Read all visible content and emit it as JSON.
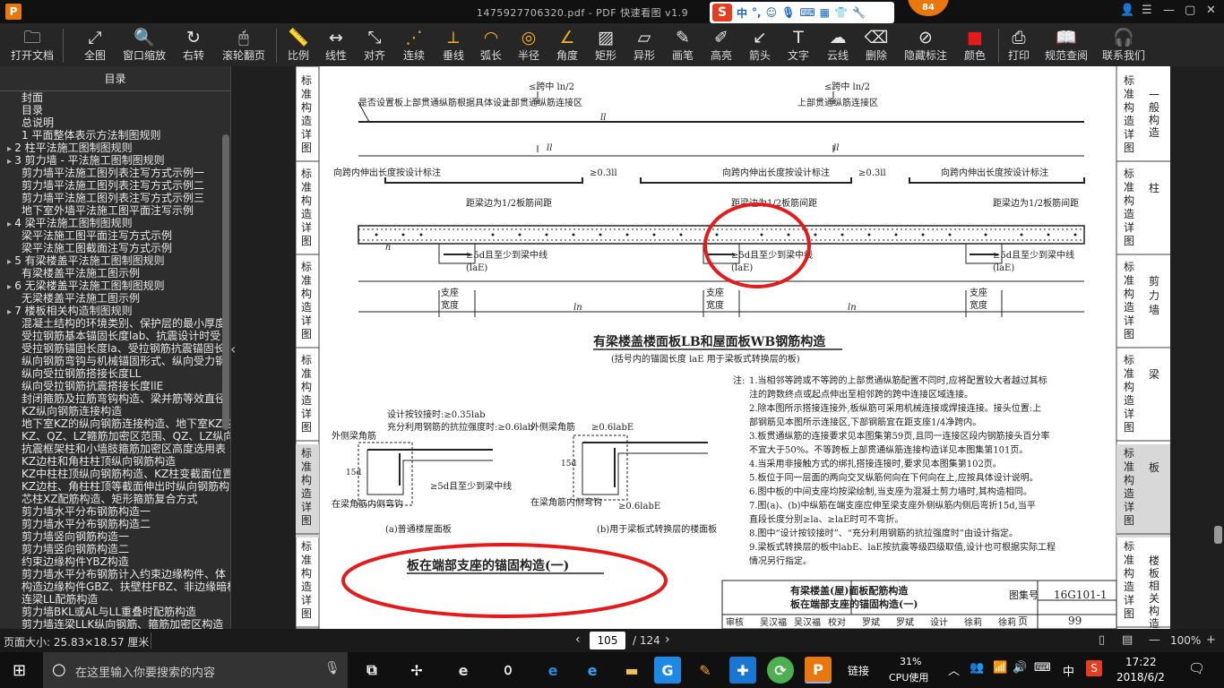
{
  "window": {
    "title": "1475927706320.pdf - PDF 快速看图 v1.9",
    "logo": "P",
    "badge": "84"
  },
  "ime": {
    "logo": "S",
    "mode": "中",
    "punct": "°,",
    "icons": [
      "smile-icon",
      "mic-icon",
      "keyboard-icon",
      "grid-icon",
      "shirt-icon",
      "wrench-icon"
    ]
  },
  "toolbar": [
    {
      "id": "open",
      "label": "打开文档",
      "icon": "folder-icon"
    },
    {
      "id": "fit",
      "label": "全图",
      "icon": "expand-icon"
    },
    {
      "id": "zoomwin",
      "label": "窗口缩放",
      "icon": "magnifier-icon"
    },
    {
      "id": "rotate",
      "label": "右转",
      "icon": "rotate-icon"
    },
    {
      "id": "scroll",
      "label": "滚轮翻页",
      "icon": "mouse-icon"
    },
    {
      "id": "scale",
      "label": "比例",
      "icon": "ruler-icon"
    },
    {
      "id": "linear",
      "label": "线性",
      "icon": "linear-dim-icon"
    },
    {
      "id": "align",
      "label": "对齐",
      "icon": "aligned-dim-icon"
    },
    {
      "id": "cont",
      "label": "连续",
      "icon": "continuous-icon"
    },
    {
      "id": "perp",
      "label": "垂线",
      "icon": "perpendicular-icon"
    },
    {
      "id": "arc",
      "label": "弧长",
      "icon": "arc-icon"
    },
    {
      "id": "radius",
      "label": "半径",
      "icon": "radius-icon"
    },
    {
      "id": "angle",
      "label": "角度",
      "icon": "angle-icon"
    },
    {
      "id": "rect",
      "label": "矩形",
      "icon": "rect-area-icon"
    },
    {
      "id": "irreg",
      "label": "异形",
      "icon": "irregular-area-icon"
    },
    {
      "id": "pen",
      "label": "画笔",
      "icon": "pen-icon"
    },
    {
      "id": "hl",
      "label": "高亮",
      "icon": "highlighter-icon"
    },
    {
      "id": "arrow",
      "label": "箭头",
      "icon": "arrow-icon"
    },
    {
      "id": "text",
      "label": "文字",
      "icon": "text-icon"
    },
    {
      "id": "cloud",
      "label": "云线",
      "icon": "cloud-icon"
    },
    {
      "id": "del",
      "label": "删除",
      "icon": "eraser-icon"
    },
    {
      "id": "hide",
      "label": "隐藏标注",
      "icon": "eye-off-icon"
    },
    {
      "id": "color",
      "label": "颜色",
      "icon": "color-swatch-icon"
    },
    {
      "id": "print",
      "label": "打印",
      "icon": "printer-icon"
    },
    {
      "id": "spec",
      "label": "规范查阅",
      "icon": "book-icon"
    },
    {
      "id": "contact",
      "label": "联系我们",
      "icon": "headset-icon"
    }
  ],
  "colors": {
    "swatch": "#ff0000",
    "accent": "#f2b01d",
    "markup": "#e51b1b"
  },
  "sidebar": {
    "title": "目录",
    "items": [
      {
        "t": "封面",
        "ar": false
      },
      {
        "t": "目录",
        "ar": false
      },
      {
        "t": "总说明",
        "ar": false
      },
      {
        "t": "1  平面整体表示方法制图规则",
        "ar": false
      },
      {
        "t": "2  柱平法施工图制图规则",
        "ar": true
      },
      {
        "t": "3  剪力墙 - 平法施工图制图规则",
        "ar": true
      },
      {
        "t": "剪力墙平法施工图列表注写方式示例一",
        "ar": false
      },
      {
        "t": "剪力墙平法施工图列表注写方式示例二",
        "ar": false
      },
      {
        "t": "剪力墙平法施工图列表注写方式示例三",
        "ar": false
      },
      {
        "t": "地下室外墙平法施工图平面注写示例",
        "ar": false
      },
      {
        "t": "4  梁平法施工图制图规则",
        "ar": true
      },
      {
        "t": "梁平法施工图平面注写方式示例",
        "ar": false
      },
      {
        "t": "梁平法施工图截面注写方式示例",
        "ar": false
      },
      {
        "t": "5  有梁楼盖平法施工图制图规则",
        "ar": true
      },
      {
        "t": "有梁楼盖平法施工图示例",
        "ar": false
      },
      {
        "t": "6  无梁楼盖平法施工图制图规则",
        "ar": true
      },
      {
        "t": "无梁楼盖平法施工图示例",
        "ar": false
      },
      {
        "t": "7  楼板相关构造制图规则",
        "ar": true
      },
      {
        "t": "混凝土结构的环境类别、保护层的最小厚度",
        "ar": false
      },
      {
        "t": "受拉钢筋基本锚固长度lab、抗震设计时受",
        "ar": false
      },
      {
        "t": "受拉钢筋锚固长度la、受拉钢筋抗震锚固长",
        "ar": false
      },
      {
        "t": "纵向钢筋弯钩与机械锚固形式、纵向受力钢",
        "ar": false
      },
      {
        "t": "纵向受拉钢筋搭接长度LL",
        "ar": false
      },
      {
        "t": "纵向受拉钢筋抗震搭接长度llE",
        "ar": false
      },
      {
        "t": "封闭箍筋及拉筋弯钩构造、梁并筋等效直径",
        "ar": false
      },
      {
        "t": "KZ纵向钢筋连接构造",
        "ar": false
      },
      {
        "t": "地下室KZ的纵向钢筋连接构造、地下室KZ的",
        "ar": false
      },
      {
        "t": "KZ、QZ、LZ箍筋加密区范围、QZ、LZ纵向钢",
        "ar": false
      },
      {
        "t": "抗震框架柱和小墙肢箍筋加密区高度选用表",
        "ar": false
      },
      {
        "t": "KZ边柱和角柱柱顶纵向钢筋构造",
        "ar": false
      },
      {
        "t": "KZ中柱柱顶纵向钢筋构造、KZ柱变截面位置",
        "ar": false
      },
      {
        "t": "KZ边柱、角柱柱顶等截面伸出时纵向钢筋构",
        "ar": false
      },
      {
        "t": "芯柱XZ配筋构造、矩形箍筋复合方式",
        "ar": false
      },
      {
        "t": "剪力墙水平分布钢筋构造一",
        "ar": false
      },
      {
        "t": "剪力墙水平分布钢筋构造二",
        "ar": false
      },
      {
        "t": "剪力墙竖向钢筋构造一",
        "ar": false
      },
      {
        "t": "剪力墙竖向钢筋构造二",
        "ar": false
      },
      {
        "t": "约束边缘构件YBZ构造",
        "ar": false
      },
      {
        "t": "剪力墙水平分布钢筋计入约束边缘构件、体",
        "ar": false
      },
      {
        "t": "构造边缘构件GBZ、扶壁柱FBZ、非边缘暗柱",
        "ar": false
      },
      {
        "t": "连梁LL配筋构造",
        "ar": false
      },
      {
        "t": "剪力墙BKL或AL与LL重叠时配筋构造",
        "ar": false
      },
      {
        "t": "剪力墙连梁LLK纵向钢筋、箍筋加密区构造",
        "ar": false
      }
    ]
  },
  "drawing": {
    "side_tabs_left": [
      "标准构造详图",
      "标准构造详图",
      "标准构造详图",
      "标准构造详图",
      "标准构造详图",
      "标准构造详图"
    ],
    "side_tabs_right": [
      {
        "t": "标准构造详图",
        "k": "一般构造"
      },
      {
        "t": "标准构造详图",
        "k": "柱"
      },
      {
        "t": "标准构造详图",
        "k": "剪力墙"
      },
      {
        "t": "标准构造详图",
        "k": "梁"
      },
      {
        "t": "标准构造详图",
        "k": "板"
      },
      {
        "t": "标准构造详图",
        "k": "楼板相关构造"
      }
    ],
    "top_label_left": "是否设置板上部贯通纵筋根据具体设计",
    "span_label_1": "≤跨中 ln/2",
    "span_label_2": "≤跨中 ln/2",
    "splice_zone_1": "上部贯通纵筋连接区",
    "splice_zone_2": "上部贯通纵筋连接区",
    "ll1": "ll",
    "ll2": "ll",
    "ext_1": "向跨内伸出长度按设计标注",
    "ext_2": "向跨内伸出长度按设计标注",
    "ext_3": "向跨内伸出长度按设计标注",
    "ge03_1": "≥0.3ll",
    "ge03_2": "≥0.3ll",
    "edge_1": "距梁边为1/2板筋间距",
    "edge_2": "距梁边为1/2板筋间距",
    "edge_3": "距梁边为1/2板筋间距",
    "anch_1": "≥5d且至少到梁中线",
    "anch_1b": "(laE)",
    "anch_2": "≥5d且至少到梁中线",
    "anch_2b": "(laE)",
    "anch_3": "≥5d且至少到梁中线",
    "anch_3b": "(laE)",
    "support": "支座",
    "width": "宽度",
    "ln": "ln",
    "h": "h",
    "main_title": "有梁楼盖楼面板LB和屋面板WB钢筋构造",
    "main_sub": "(括号内的锚固长度 laE 用于梁板式转换层的板)",
    "det_a_t1": "设计按铰接时:≥0.35lab",
    "det_a_t2": "充分利用钢筋的抗拉强度时:≥0.6lab",
    "det_a_side": "外侧梁角筋",
    "det_a_15d": "15d",
    "det_a_anch": "≥5d且至少到梁中线",
    "det_a_inside": "在梁角筋内侧弯钩",
    "det_a_caption": "(a)普通楼屋面板",
    "det_b_t1": "≥0.6labE",
    "det_b_side": "外侧梁角筋",
    "det_b_15d": "15d",
    "det_b_inside": "在梁角筋内侧弯钩",
    "det_b_t2": "≥0.6labE",
    "det_b_caption": "(b)用于梁板式转换层的楼面板",
    "end_title": "板在端部支座的锚固构造(一)",
    "notes_head": "注:",
    "notes": [
      "1.当相邻等跨或不等跨的上部贯通纵筋配置不同时,应将配置较大者越过其标",
      "  注的跨数终点或起点伸出至相邻跨的跨中连接区域连接。",
      "2.除本图所示搭接连接外,板纵筋可采用机械连接或焊接连接。接头位置:上",
      "  部钢筋见本图所示连接区,下部钢筋宜在距支座1/4净跨内。",
      "3.板贯通纵筋的连接要求见本图集第59页,且同一连接区段内钢筋接头百分率",
      "  不宜大于50%。不等跨板上部贯通纵筋连接构造详见本图集第101页。",
      "4.当采用非接触方式的绑扎搭接连接时,要求见本图集第102页。",
      "5.板位于同一层面的两向交叉纵筋何向在下何向在上,应按具体设计说明。",
      "6.图中板的中间支座均按梁绘制,当支座为混凝土剪力墙时,其构造相同。",
      "7.图(a)、(b)中纵筋在端支座应伸至梁支座外侧纵筋内侧后弯折15d,当平",
      "  直段长度分别≥la、≥laE时可不弯折。",
      "8.图中“设计按铰接时”、“充分利用钢筋的抗拉强度时”由设计指定。",
      "9.梁板式转换层的板中labE、laE按抗震等级四级取值,设计也可根据实际工程",
      "  情况另行指定。"
    ],
    "tb_title1": "有梁楼盖(屋)面板配筋构造",
    "tb_title2": "板在端部支座的锚固构造(一)",
    "tb_setno_label": "图集号",
    "tb_setno": "16G101-1",
    "tb_page_label": "页",
    "tb_page": "99",
    "tb_sign": [
      "审核",
      "吴汉福",
      "吴汉福",
      "校对",
      "罗斌",
      "罗斌",
      "设计",
      "徐莉",
      "徐莉"
    ]
  },
  "status": {
    "pagesize": "页面大小: 25.83×18.57 厘米",
    "page": "105",
    "total": "/ 124",
    "zoom": "100%"
  },
  "taskbar": {
    "search": "在这里输入你要搜索的内容",
    "link": "链接",
    "cpu_pct": "31%",
    "cpu_label": "CPU使用",
    "ime": "中",
    "time": "17:22",
    "date": "2018/6/2"
  }
}
